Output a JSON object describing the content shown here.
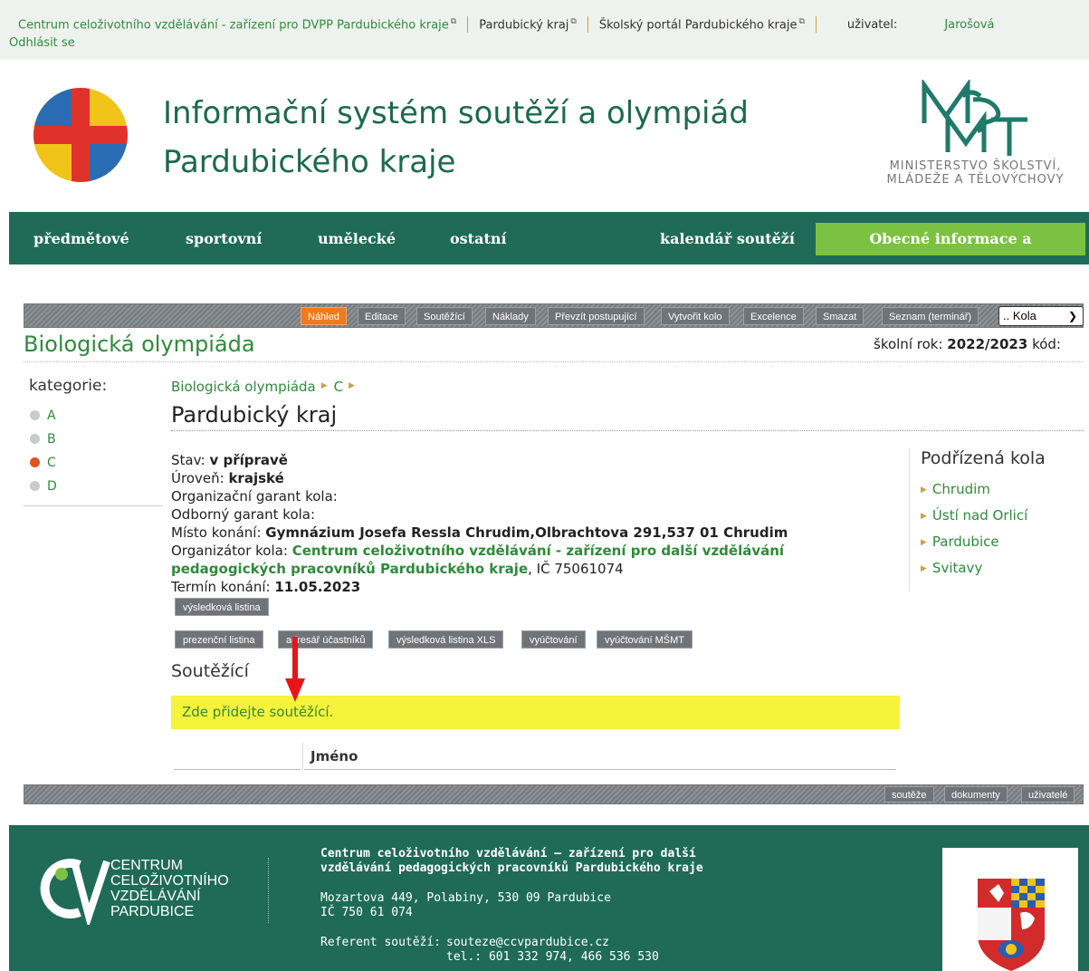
{
  "topbar": {
    "link_ccv": "Centrum celoživotního vzdělávání - zařízení pro DVPP Pardubického kraje",
    "link_kraj": "Pardubický kraj",
    "link_portal": "Školský portál Pardubického kraje",
    "user_label": "uživatel:",
    "user_name": "Jarošová",
    "logout": "Odhlásit se"
  },
  "header": {
    "title_line1": "Informační systém soutěží a olympiád",
    "title_line2": "Pardubického kraje",
    "ministry_line1": "MINISTERSTVO ŠKOLSTVÍ,",
    "ministry_line2": "MLÁDEŽE A TĚLOVÝCHOVY"
  },
  "nav": {
    "predmetove": "předmětové",
    "sportovni": "sportovní",
    "umelecke": "umělecké",
    "ostatni": "ostatní",
    "kalendar": "kalendář soutěží",
    "obecne": "Obecné informace a aktuality"
  },
  "toolbar": {
    "nahled": "Náhled",
    "editace": "Editace",
    "soutezici": "Soutěžící",
    "naklady": "Náklady",
    "prevzit": "Převzít postupující",
    "vytvorit": "Vytvořit kolo",
    "excelence": "Excelence",
    "smazat": "Smazat",
    "seznam": "Seznam (terminář)",
    "select_value": ".. Kola"
  },
  "page": {
    "subject": "Biologická olympiáda",
    "school_year_label": "školní rok:",
    "school_year_value": "2022/2023",
    "code_label": "kód:"
  },
  "categories": {
    "label": "kategorie:",
    "items": [
      "A",
      "B",
      "C",
      "D"
    ],
    "active": "C"
  },
  "breadcrumb": {
    "item1": "Biologická olympiáda",
    "item2": "C"
  },
  "round": {
    "title": "Pardubický kraj",
    "stav_label": "Stav:",
    "stav_value": "v přípravě",
    "uroven_label": "Úroveň:",
    "uroven_value": "krajské",
    "org_garant_label": "Organizační garant kola:",
    "odb_garant_label": "Odborný garant kola:",
    "misto_label": "Místo konání:",
    "misto_value": "Gymnázium Josefa Ressla Chrudim,Olbrachtova 291,537 01 Chrudim",
    "organizator_label": "Organizátor kola:",
    "organizator_value": "Centrum celoživotního vzdělávání - zařízení pro další vzdělávání pedagogických pracovníků Pardubického kraje",
    "ic": ", IČ 75061074",
    "termin_label": "Termín konání:",
    "termin_value": "11.05.2023"
  },
  "buttons": {
    "vysledkova": "výsledková listina",
    "prezencni": "prezenční listina",
    "adresar": "adresář účastníků",
    "vysledkova_xls": "výsledková listina XLS",
    "vyuctovani": "vyúčtování",
    "vyuctovani_msmt": "vyúčtování MŠMT"
  },
  "competitors": {
    "heading": "Soutěžící",
    "notice": "Zde přidejte soutěžící.",
    "col_name": "Jméno"
  },
  "subrounds": {
    "heading": "Podřízená kola",
    "items": [
      "Chrudim",
      "Ústí nad Orlicí",
      "Pardubice",
      "Svitavy"
    ]
  },
  "bottom_toolbar": {
    "souteze": "soutěže",
    "dokumenty": "dokumenty",
    "uzivatele": "uživatelé"
  },
  "footer": {
    "ccv_line1": "CENTRUM",
    "ccv_line2": "CELOŽIVOTNÍHO",
    "ccv_line3": "VZDĚLÁVÁNÍ",
    "ccv_line4": "PARDUBICE",
    "org_line1": "Centrum celoživotního vzdělávání – zařízení pro další",
    "org_line2": "vzdělávání pedagogických pracovníků Pardubického kraje",
    "addr_line1": "Mozartova 449, Polabiny, 530 09 Pardubice",
    "addr_line2": "IČ 750 61 074",
    "ref_label": "Referent soutěží:",
    "ref_email": "souteze@ccvpardubice.cz",
    "ref_tel": "tel.: 601 332 974, 466 536 530"
  },
  "colors": {
    "brand_green": "#1f6b58",
    "link_green": "#2e8b3a",
    "accent_lime": "#7bc142",
    "active_orange": "#f07a1c",
    "notice_yellow": "#f7f23a",
    "annotation_red": "#e8141a"
  }
}
